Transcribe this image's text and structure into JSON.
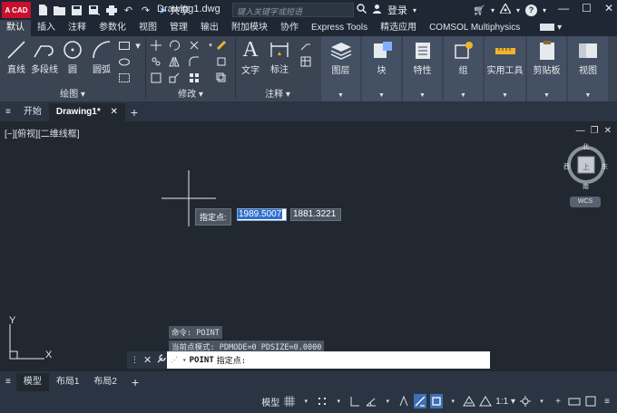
{
  "app": {
    "logo_text": "A CAD",
    "share_label": "共享",
    "doc_title": "Drawing1.dwg",
    "search_placeholder": "键入关键字或短语",
    "login_label": "登录"
  },
  "ribbon_tabs": [
    {
      "label": "默认",
      "active": true
    },
    {
      "label": "插入"
    },
    {
      "label": "注释"
    },
    {
      "label": "参数化"
    },
    {
      "label": "视图"
    },
    {
      "label": "管理"
    },
    {
      "label": "输出"
    },
    {
      "label": "附加模块"
    },
    {
      "label": "协作"
    },
    {
      "label": "Express Tools"
    },
    {
      "label": "精选应用"
    },
    {
      "label": "COMSOL Multiphysics"
    }
  ],
  "ribbon": {
    "draw": {
      "line": "直线",
      "polyline": "多段线",
      "circle": "圆",
      "arc": "圆弧",
      "group": "绘图"
    },
    "modify": {
      "group": "修改"
    },
    "annotation": {
      "text": "文字",
      "dimension": "标注",
      "group": "注释"
    },
    "panels": [
      {
        "label": "图层",
        "icon": "layers-icon"
      },
      {
        "label": "块",
        "icon": "block-icon"
      },
      {
        "label": "特性",
        "icon": "properties-icon"
      },
      {
        "label": "组",
        "icon": "group-icon"
      },
      {
        "label": "实用工具",
        "icon": "measure-icon"
      },
      {
        "label": "剪贴板",
        "icon": "clipboard-icon"
      },
      {
        "label": "视图",
        "icon": "view-icon"
      }
    ]
  },
  "doc_tabs": {
    "start": "开始",
    "drawing": "Drawing1*"
  },
  "viewport": {
    "label": "[−][俯视][二维线框]",
    "compass": {
      "n": "北",
      "s": "南",
      "e": "东",
      "w": "西",
      "center": "上",
      "wcs": "WCS"
    }
  },
  "cursor_input": {
    "prompt": "指定点:",
    "x": "1989.5007",
    "y": "1881.3221"
  },
  "command": {
    "history": [
      "命令: POINT",
      "当前点模式:  PDMODE=0  PDSIZE=0.0000"
    ],
    "current_cmd": "POINT",
    "current_prompt": "指定点:"
  },
  "ucs": {
    "x": "X",
    "y": "Y"
  },
  "layout_tabs": [
    {
      "label": "模型",
      "active": true
    },
    {
      "label": "布局1"
    },
    {
      "label": "布局2"
    }
  ],
  "statusbar": {
    "model": "模型",
    "scale": "1:1"
  },
  "colors": {
    "accent": "#3f6fb5",
    "canvas": "#212830",
    "ribbon": "#3b4453",
    "logo": "#c8102e"
  }
}
